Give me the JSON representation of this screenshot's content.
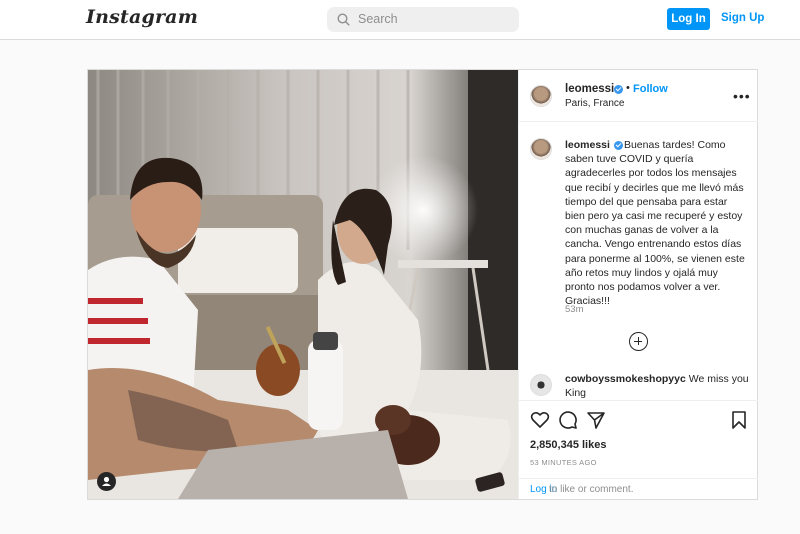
{
  "header": {
    "logo": "Instagram",
    "search_placeholder": "Search",
    "login_label": "Log In",
    "signup_label": "Sign Up"
  },
  "post": {
    "username": "leomessi",
    "follow_label": "Follow",
    "separator": "•",
    "location": "Paris, France",
    "more_label": "•••",
    "caption_user": "leomessi",
    "caption_text": "Buenas tardes! Como saben tuve COVID y quería agradecerles por todos los mensajes que recibí y decirles que me llevó más tiempo del que pensaba para estar bien pero ya casi me recuperé y estoy con muchas ganas de volver a la cancha. Vengo entrenando estos días para ponerme al 100%, se vienen este año retos muy lindos y ojalá muy pronto nos podamos volver a ver. Gracias!!!",
    "caption_time": "53m",
    "comment_user": "cowboyssmokeshopyyc",
    "comment_text": "We miss you King",
    "likes": "2,850,345 likes",
    "posted_ago": "53 MINUTES AGO",
    "login_link": "Log in",
    "login_rest": "to like or comment."
  },
  "icons": {
    "search": "search-icon",
    "verified": "verified-badge-icon",
    "add": "plus-circle-icon",
    "like": "heart-icon",
    "comment": "comment-icon",
    "share": "paper-plane-icon",
    "save": "bookmark-icon",
    "tagged": "user-tag-icon"
  },
  "colors": {
    "accent": "#0095f6",
    "verified": "#3897f0",
    "text": "#262626",
    "muted": "#8e8e8e"
  }
}
